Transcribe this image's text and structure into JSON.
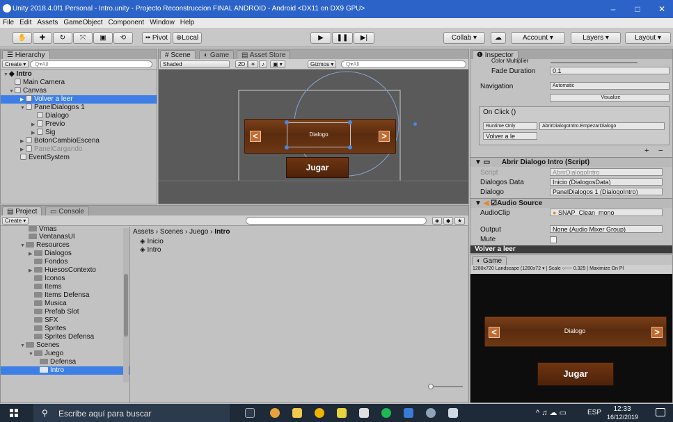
{
  "window": {
    "title": "Unity 2018.4.0f1 Personal - Intro.unity - Projecto Reconstruccion FINAL ANDROID - Android <DX11 on DX9 GPU>",
    "controls": {
      "minimize": "‒",
      "maximize": "□",
      "close": "✕"
    }
  },
  "menu": [
    "File",
    "Edit",
    "Assets",
    "GameObject",
    "Component",
    "Window",
    "Help"
  ],
  "toolbar": {
    "pivot": "Pivot",
    "local": "Local",
    "collab": "Collab ▾",
    "account": "Account",
    "layers": "Layers",
    "layout": "Layout"
  },
  "hierarchy": {
    "tab": "Hierarchy",
    "create": "Create ▾",
    "search_placeholder": "Q▾All",
    "scene": "Intro",
    "items": [
      {
        "label": "Main Camera"
      },
      {
        "label": "Canvas"
      },
      {
        "label": "Volver a leer"
      },
      {
        "label": "PanelDialogos 1"
      },
      {
        "label": "Dialogo"
      },
      {
        "label": "Previo"
      },
      {
        "label": "Sig"
      },
      {
        "label": "BotonCambioEscena"
      },
      {
        "label": "PanelCargando"
      },
      {
        "label": "EventSystem"
      }
    ]
  },
  "scene": {
    "tabs": [
      "Scene",
      "Game",
      "Asset Store"
    ],
    "shading": "Shaded",
    "mode2d": "2D",
    "gizmos": "Gizmos ▾",
    "search_placeholder": "Q▾All",
    "dialog_label": "Dialogo",
    "prev_label": "<",
    "next_label": ">",
    "play_label": "Jugar"
  },
  "project": {
    "tabs": [
      "Project",
      "Console"
    ],
    "create": "Create ▾",
    "breadcrumb": [
      "Assets",
      "Scenes",
      "Juego",
      "Intro"
    ],
    "tree": [
      {
        "label": "Vmas"
      },
      {
        "label": "VentanasUI"
      },
      {
        "label": "Resources"
      },
      {
        "label": "Dialogos"
      },
      {
        "label": "Fondos"
      },
      {
        "label": "HuesosContexto"
      },
      {
        "label": "Iconos"
      },
      {
        "label": "Items"
      },
      {
        "label": "Items Defensa"
      },
      {
        "label": "Musica"
      },
      {
        "label": "Prefab Slot"
      },
      {
        "label": "SFX"
      },
      {
        "label": "Sprites"
      },
      {
        "label": "Sprites Defensa"
      },
      {
        "label": "Scenes"
      },
      {
        "label": "Juego"
      },
      {
        "label": "Defensa"
      },
      {
        "label": "Intro"
      }
    ],
    "files": [
      "Inicio",
      "Intro"
    ]
  },
  "inspector": {
    "tab": "Inspector",
    "color_multiplier": "Color Multiplier",
    "fade_duration_label": "Fade Duration",
    "fade_duration_value": "0.1",
    "navigation_label": "Navigation",
    "navigation_value": "Automatic",
    "visualize": "Visualize",
    "onclick": "On Click ()",
    "runtime": "Runtime Only",
    "function": "AbrirDialogoIntro.EmpezarDialogo",
    "target": "Volver a le",
    "plus": "+",
    "minus": "−",
    "script_component": "Abrir Dialogo Intro (Script)",
    "script_label": "Script",
    "script_value": "AbrirDialogoIntro",
    "dialogos_data_label": "Dialogos Data",
    "dialogos_data_value": "Inicio (DialogosData)",
    "dialogo_label": "Dialogo",
    "dialogo_value": "PanelDialogos 1 (DialogoIntro)",
    "audio_component": "Audio Source",
    "audioclip_label": "AudioClip",
    "audioclip_value": "SNAP_Clean_mono",
    "output_label": "Output",
    "output_value": "None (Audio Mixer Group)",
    "mute_label": "Mute",
    "preview_name": "Volver a leer"
  },
  "game_preview": {
    "tab": "Game",
    "resolution": "1280x720 Landscape (1280x72",
    "scale_label": "Scale",
    "scale_value": "0.325",
    "maximize": "Maximize On Pl",
    "dialog_label": "Dialogo",
    "prev_label": "<",
    "next_label": ">",
    "play_label": "Jugar"
  },
  "taskbar": {
    "search_placeholder": "Escribe aquí para buscar",
    "lang": "ESP",
    "time": "12:33",
    "date": "16/12/2019"
  },
  "colors": {
    "titlebar": "#2b63c9",
    "selection": "#3d7fe6",
    "wood": "#6e3814",
    "game_bg": "#0d0d0d"
  }
}
